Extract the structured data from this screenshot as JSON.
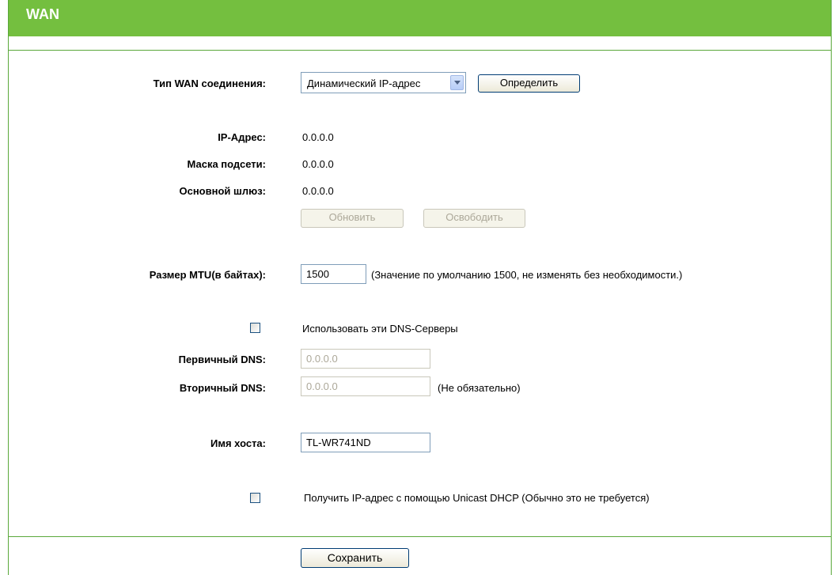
{
  "header": {
    "title": "WAN"
  },
  "wan_type": {
    "label": "Тип WAN соединения:",
    "selected": "Динамический IP-адрес",
    "detect_button": "Определить"
  },
  "status": {
    "ip_label": "IP-Адрес:",
    "ip_value": "0.0.0.0",
    "mask_label": "Маска подсети:",
    "mask_value": "0.0.0.0",
    "gateway_label": "Основной шлюз:",
    "gateway_value": "0.0.0.0",
    "renew_button": "Обновить",
    "release_button": "Освободить"
  },
  "mtu": {
    "label": "Размер MTU(в байтах):",
    "value": "1500",
    "note": "(Значение по умолчанию 1500, не изменять без необходимости.)"
  },
  "dns": {
    "use_label": "Использовать эти DNS-Серверы",
    "primary_label": "Первичный DNS:",
    "primary_value": "0.0.0.0",
    "secondary_label": "Вторичный DNS:",
    "secondary_value": "0.0.0.0",
    "secondary_note": "(Не обязательно)"
  },
  "host": {
    "label": "Имя хоста:",
    "value": "TL-WR741ND"
  },
  "unicast": {
    "label": "Получить IP-адрес с помощью Unicast DHCP (Обычно это не требуется)"
  },
  "save_button": "Сохранить"
}
